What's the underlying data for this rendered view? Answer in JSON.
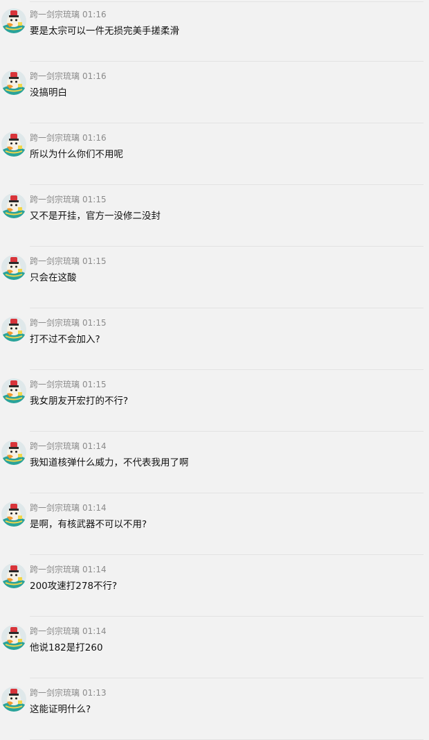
{
  "messages": [
    {
      "sender": "跨一剑宗琉璃",
      "time": "01:16",
      "text": "要是太宗可以一件无损完美手搓柔滑"
    },
    {
      "sender": "跨一剑宗琉璃",
      "time": "01:16",
      "text": "没搞明白"
    },
    {
      "sender": "跨一剑宗琉璃",
      "time": "01:16",
      "text": "所以为什么你们不用呢"
    },
    {
      "sender": "跨一剑宗琉璃",
      "time": "01:15",
      "text": "又不是开挂，官方一没修二没封"
    },
    {
      "sender": "跨一剑宗琉璃",
      "time": "01:15",
      "text": "只会在这酸"
    },
    {
      "sender": "跨一剑宗琉璃",
      "time": "01:15",
      "text": "打不过不会加入?"
    },
    {
      "sender": "跨一剑宗琉璃",
      "time": "01:15",
      "text": "我女朋友开宏打的不行?"
    },
    {
      "sender": "跨一剑宗琉璃",
      "time": "01:14",
      "text": "我知道核弹什么威力，不代表我用了啊"
    },
    {
      "sender": "跨一剑宗琉璃",
      "time": "01:14",
      "text": "是啊，有核武器不可以不用?"
    },
    {
      "sender": "跨一剑宗琉璃",
      "time": "01:14",
      "text": "200攻速打278不行?"
    },
    {
      "sender": "跨一剑宗琉璃",
      "time": "01:14",
      "text": "他说182是打260"
    },
    {
      "sender": "跨一剑宗琉璃",
      "time": "01:13",
      "text": "这能证明什么?"
    }
  ],
  "avatar_icon": "cartoon-character-avatar",
  "colors": {
    "background": "#f2f2f2",
    "meta": "#8a8a8a",
    "text": "#111111",
    "divider": "#e3e3e3"
  }
}
